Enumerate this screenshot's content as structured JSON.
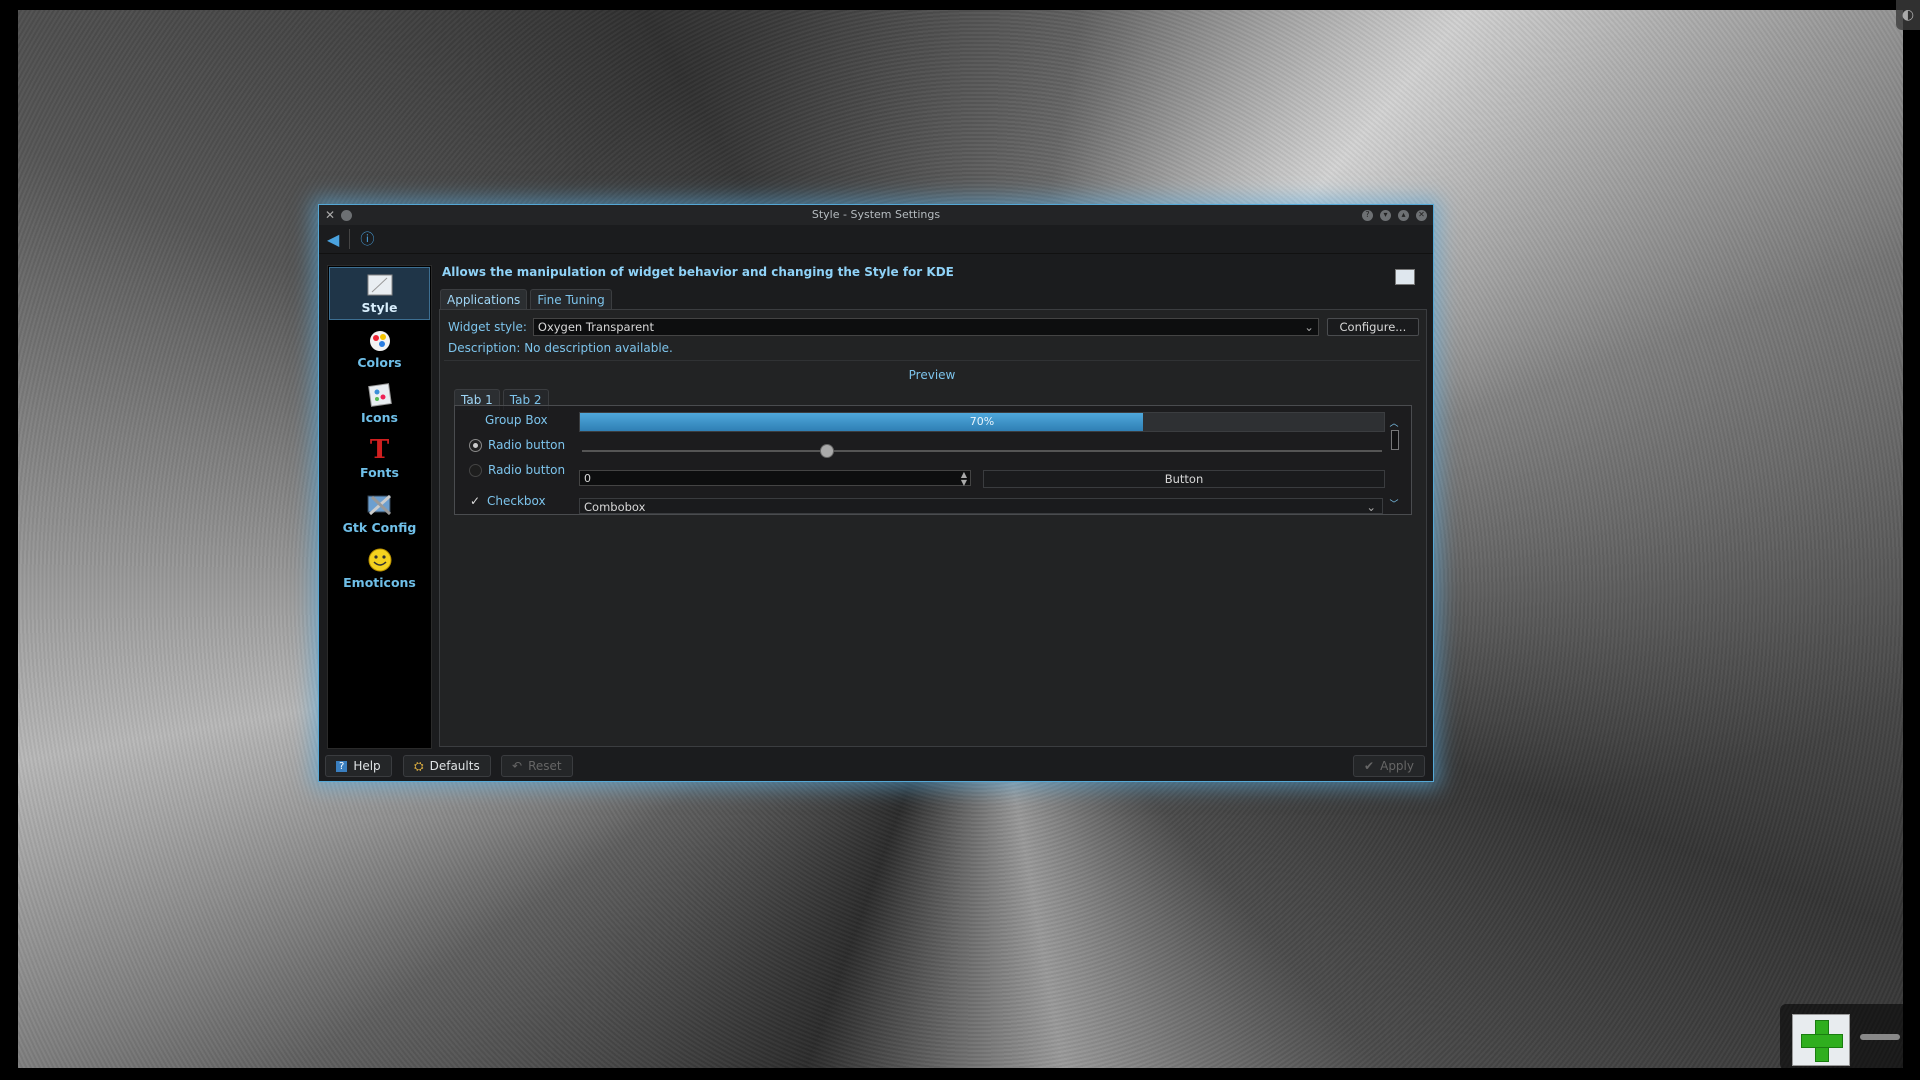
{
  "window": {
    "title": "Style - System Settings"
  },
  "sidebar": {
    "items": [
      {
        "label": "Style",
        "icon": "style-icon"
      },
      {
        "label": "Colors",
        "icon": "colors-icon"
      },
      {
        "label": "Icons",
        "icon": "icons-icon"
      },
      {
        "label": "Fonts",
        "icon": "fonts-icon"
      },
      {
        "label": "Gtk Config",
        "icon": "gtk-config-icon"
      },
      {
        "label": "Emoticons",
        "icon": "emoticons-icon"
      }
    ]
  },
  "content": {
    "heading": "Allows the manipulation of widget behavior and changing the Style for KDE",
    "tabs": [
      "Applications",
      "Fine Tuning"
    ],
    "widget_style_label": "Widget style:",
    "widget_style_value": "Oxygen Transparent",
    "configure_label": "Configure...",
    "description": "Description: No description available."
  },
  "preview": {
    "title": "Preview",
    "tabs": [
      "Tab 1",
      "Tab 2"
    ],
    "group_box_label": "Group Box",
    "radio1_label": "Radio button",
    "radio2_label": "Radio button",
    "checkbox_label": "Checkbox",
    "progress_value": 70,
    "progress_text": "70%",
    "spinbox_value": "0",
    "button_label": "Button",
    "combobox_value": "Combobox"
  },
  "bottom": {
    "help_label": "Help",
    "defaults_label": "Defaults",
    "reset_label": "Reset",
    "apply_label": "Apply"
  },
  "colors": {
    "accent": "#4fa8dc",
    "glow": "#55a8d6",
    "add_widget_green": "#2fae1e"
  }
}
